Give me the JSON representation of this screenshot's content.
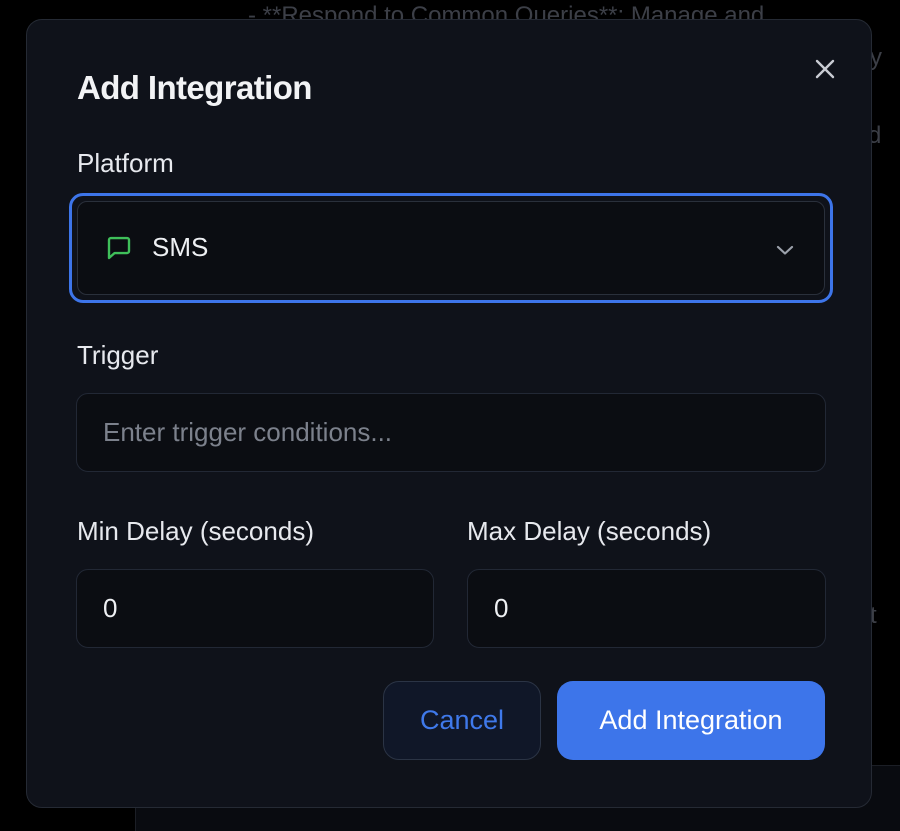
{
  "background": {
    "snippet_line_1": "- **Respond to Common Queries**: Manage and",
    "snippet_line_2": "y",
    "snippet_line_3": "d",
    "snippet_line_4": "t"
  },
  "modal": {
    "title": "Add Integration",
    "close_icon": "close-icon",
    "platform": {
      "label": "Platform",
      "selected_value": "SMS",
      "icon": "message-square-icon",
      "icon_color": "#3fbf5a"
    },
    "trigger": {
      "label": "Trigger",
      "placeholder": "Enter trigger conditions...",
      "value": ""
    },
    "min_delay": {
      "label": "Min Delay (seconds)",
      "value": "0"
    },
    "max_delay": {
      "label": "Max Delay (seconds)",
      "value": "0"
    },
    "cancel_label": "Cancel",
    "submit_label": "Add Integration"
  },
  "colors": {
    "accent": "#3d75ea",
    "modal_bg": "#0f121a",
    "sms_icon": "#3fbf5a"
  }
}
